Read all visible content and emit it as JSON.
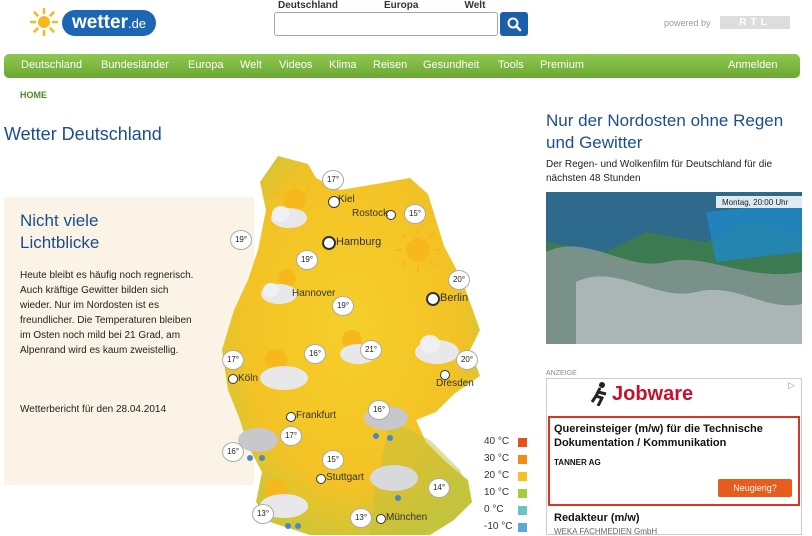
{
  "header": {
    "logo_main": "wetter",
    "logo_tld": ".de",
    "region_tabs": [
      "Deutschland",
      "Europa",
      "Welt"
    ],
    "powered_by": "powered by",
    "partner": "RTL"
  },
  "nav": {
    "items": [
      "Deutschland",
      "Bundesländer",
      "Europa",
      "Welt",
      "Videos",
      "Klima",
      "Reisen",
      "Gesundheit",
      "Tools",
      "Premium"
    ],
    "login": "Anmelden"
  },
  "breadcrumb": "HOME",
  "page_title": "Wetter Deutschland",
  "forecast": {
    "headline": "Nicht viele Lichtblicke",
    "body": "Heute bleibt es häufig noch regnerisch. Auch kräftige Gewitter bilden sich wieder. Nur im Nordosten ist es freundlicher. Die Temperaturen bleiben im Osten noch mild bei 21 Grad, am Alpenrand wird es kaum zweistellig.",
    "date_label": "Wetterbericht für den 28.04.2014"
  },
  "map": {
    "cities": [
      {
        "name": "Kiel"
      },
      {
        "name": "Rostock"
      },
      {
        "name": "Hamburg"
      },
      {
        "name": "Berlin"
      },
      {
        "name": "Hannover"
      },
      {
        "name": "Köln"
      },
      {
        "name": "Dresden"
      },
      {
        "name": "Frankfurt"
      },
      {
        "name": "Stuttgart"
      },
      {
        "name": "München"
      }
    ],
    "temps": [
      "17°",
      "15°",
      "19°",
      "19°",
      "20°",
      "19°",
      "17°",
      "16°",
      "21°",
      "20°",
      "16°",
      "17°",
      "16°",
      "15°",
      "14°",
      "13°",
      "13°"
    ]
  },
  "legend": [
    "40 °C",
    "30 °C",
    "20 °C",
    "10 °C",
    "0 °C",
    "-10 °C"
  ],
  "legend_colors": [
    "#e2531d",
    "#ef8a1b",
    "#f5c02c",
    "#a6cd3a",
    "#69c3c8",
    "#5aa6de"
  ],
  "news": {
    "title": "Nur der Nordosten ohne Regen und Gewitter",
    "subtitle": "Der Regen- und Wolkenfilm für Deutschland für die nächsten 48 Stunden",
    "radar_label": "Montag, 20:00 Uhr"
  },
  "ad": {
    "label": "ANZEIGE",
    "brand": "Jobware",
    "job1_title": "Quereinsteiger (m/w) für die Technische Dokumentation / Kommunikation",
    "job1_company": "TANNER AG",
    "cta": "Neugierig?",
    "job2_title": "Redakteur (m/w)",
    "job2_company": "WEKA FACHMEDIEN GmbH"
  }
}
